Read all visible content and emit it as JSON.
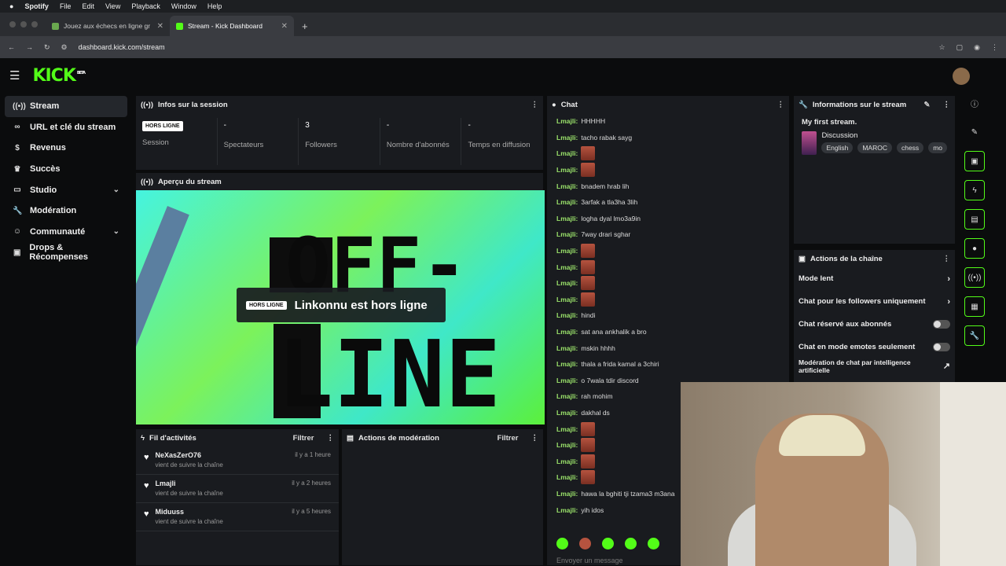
{
  "mac_menu": {
    "apple": "",
    "app": "Spotify",
    "items": [
      "File",
      "Edit",
      "View",
      "Playback",
      "Window",
      "Help"
    ]
  },
  "tabs": [
    {
      "title": "Jouez aux échecs en ligne gr",
      "active": false
    },
    {
      "title": "Stream - Kick Dashboard",
      "active": true
    }
  ],
  "new_tab": "+",
  "address": {
    "url": "dashboard.kick.com/stream"
  },
  "logo": {
    "text": "KICK",
    "beta": "BETA"
  },
  "sidebar": {
    "items": [
      {
        "label": "Stream",
        "icon": "broadcast-icon",
        "glyph": "((•))",
        "active": true
      },
      {
        "label": "URL et clé du stream",
        "icon": "link-icon",
        "glyph": "🔗"
      },
      {
        "label": "Revenus",
        "icon": "dollar-icon",
        "glyph": "$"
      },
      {
        "label": "Succès",
        "icon": "trophy-icon",
        "glyph": "🏆"
      },
      {
        "label": "Studio",
        "icon": "monitor-icon",
        "glyph": "▭",
        "expand": true
      },
      {
        "label": "Modération",
        "icon": "wrench-icon",
        "glyph": "🔧"
      },
      {
        "label": "Communauté",
        "icon": "people-icon",
        "glyph": "👥",
        "expand": true
      },
      {
        "label": "Drops & Récompenses",
        "icon": "gift-icon",
        "glyph": "🎁"
      }
    ]
  },
  "session": {
    "title": "Infos sur la session",
    "badge": "HORS LIGNE",
    "stats": [
      {
        "value": "",
        "label": "Session"
      },
      {
        "value": "-",
        "label": "Spectateurs"
      },
      {
        "value": "3",
        "label": "Followers"
      },
      {
        "value": "-",
        "label": "Nombre d'abonnés"
      },
      {
        "value": "-",
        "label": "Temps en diffusion"
      }
    ]
  },
  "preview": {
    "title": "Aperçu du stream",
    "offline_word_1": "OFF-",
    "offline_word_2": "LINE",
    "badge": "HORS LIGNE",
    "status": "Linkonnu est hors ligne"
  },
  "activity": {
    "title": "Fil d'activités",
    "filter": "Filtrer",
    "items": [
      {
        "name": "NeXasZerO76",
        "sub": "vient de suivre la chaîne",
        "time": "il y a 1 heure"
      },
      {
        "name": "Lmajli",
        "sub": "vient de suivre la chaîne",
        "time": "il y a 2 heures"
      },
      {
        "name": "Miduuss",
        "sub": "vient de suivre la chaîne",
        "time": "il y a 5 heures"
      }
    ]
  },
  "moderation": {
    "title": "Actions de modération",
    "filter": "Filtrer"
  },
  "chat": {
    "title": "Chat",
    "lines": [
      {
        "user": "Lmajli:",
        "text": "HHHHH"
      },
      {
        "user": "Lmajli:",
        "text": "tacho rabak sayg"
      },
      {
        "user": "Lmajli:",
        "emote": true
      },
      {
        "user": "Lmajli:",
        "emote": true
      },
      {
        "user": "Lmajli:",
        "text": "bnadem hrab lih"
      },
      {
        "user": "Lmajli:",
        "text": "3arfak a tla3ha 3lih"
      },
      {
        "user": "Lmajli:",
        "text": "logha dyal lmo3a9in"
      },
      {
        "user": "Lmajli:",
        "text": "7way drari sghar"
      },
      {
        "user": "Lmajli:",
        "emote": true
      },
      {
        "user": "Lmajli:",
        "emote": true
      },
      {
        "user": "Lmajli:",
        "emote": true
      },
      {
        "user": "Lmajli:",
        "emote": true
      },
      {
        "user": "Lmajli:",
        "text": "hindi"
      },
      {
        "user": "Lmajli:",
        "text": "sat ana ankhalik a bro"
      },
      {
        "user": "Lmajli:",
        "text": "mskin hhhh"
      },
      {
        "user": "Lmajli:",
        "text": "thala a frida kamal a 3chiri"
      },
      {
        "user": "Lmajli:",
        "text": "o 7wala tdir discord"
      },
      {
        "user": "Lmajli:",
        "text": "rah mohim"
      },
      {
        "user": "Lmajli:",
        "text": "dakhal ds"
      },
      {
        "user": "Lmajli:",
        "emote": true
      },
      {
        "user": "Lmajli:",
        "emote": true
      },
      {
        "user": "Lmajli:",
        "emote": true
      },
      {
        "user": "Lmajli:",
        "emote": true
      },
      {
        "user": "Lmajli:",
        "text": "hawa la bghiti tji tzama3 m3ana"
      },
      {
        "user": "Lmajli:",
        "text": "yih idos"
      }
    ],
    "input_placeholder": "Envoyer un message"
  },
  "stream_info": {
    "title": "Informations sur le stream",
    "stream_title": "My first stream.",
    "category": "Discussion",
    "tags": [
      "English",
      "MAROC",
      "chess",
      "mo"
    ]
  },
  "channel_actions": {
    "title": "Actions de la chaîne",
    "items": [
      {
        "label": "Mode lent",
        "type": "arrow"
      },
      {
        "label": "Chat pour les followers uniquement",
        "type": "arrow"
      },
      {
        "label": "Chat réservé aux abonnés",
        "type": "toggle"
      },
      {
        "label": "Chat en mode emotes seulement",
        "type": "toggle"
      },
      {
        "label": "Modération de chat par intelligence artificielle",
        "type": "external"
      }
    ]
  },
  "rail_icons": [
    "info-icon",
    "pencil-icon",
    "screen-icon",
    "bolt-icon",
    "note-icon",
    "chat-icon",
    "broadcast-icon",
    "layout-icon",
    "wrench-icon",
    "people-icon"
  ],
  "colors": {
    "accent": "#53fc18",
    "bg": "#0b0c0d",
    "panel": "#191b1f"
  }
}
